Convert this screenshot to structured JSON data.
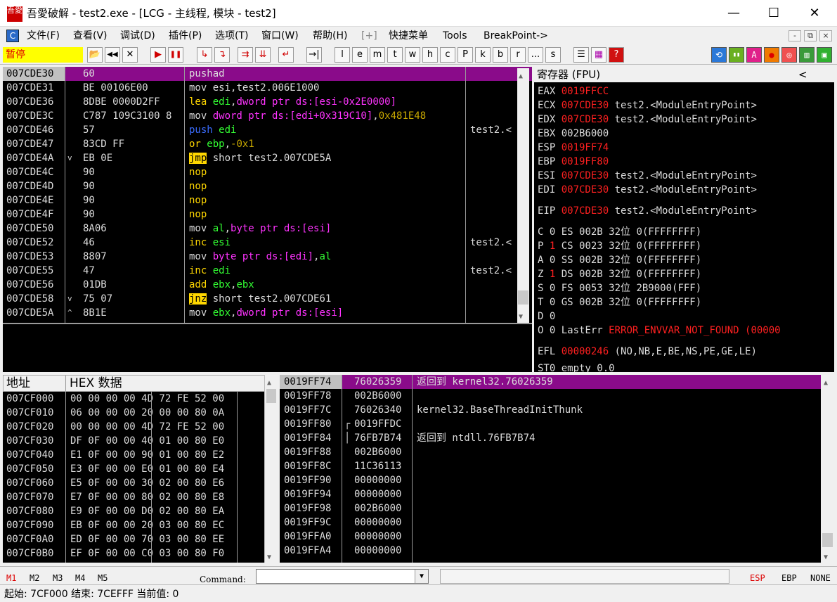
{
  "window": {
    "logo_text": "吾愛",
    "title": "吾愛破解 - test2.exe - [LCG - 主线程, 模块 - test2]",
    "minimize": "—",
    "maximize": "☐",
    "close": "✕"
  },
  "menu": {
    "items": [
      "文件(F)",
      "查看(V)",
      "调试(D)",
      "插件(P)",
      "选项(T)",
      "窗口(W)",
      "帮助(H)",
      "[+]",
      "快捷菜单",
      "Tools",
      "BreakPoint->"
    ],
    "mdi": [
      "-",
      "⧉",
      "×"
    ]
  },
  "toolbar": {
    "status": "暂停",
    "buttons": [
      "📂",
      "◀◀",
      "✕",
      "▶",
      "❚❚",
      "↳",
      "↴",
      "⇉",
      "⇊",
      "↵",
      "→|"
    ],
    "letters": [
      "l",
      "e",
      "m",
      "t",
      "w",
      "h",
      "c",
      "P",
      "k",
      "b",
      "r",
      "...",
      "s"
    ],
    "right": [
      "☰",
      "▦",
      "?"
    ],
    "plugin_icons": [
      "⟲",
      "▮▮",
      "A",
      "●",
      "◎",
      "▥",
      "▣"
    ]
  },
  "cpu": {
    "rows": [
      {
        "addr": "007CDE30",
        "hex": "60",
        "asm": [
          {
            "t": "pushad",
            "c": "txt"
          }
        ],
        "cmt": "",
        "sel": true
      },
      {
        "addr": "007CDE31",
        "hex": "BE 00106E00",
        "asm": [
          {
            "t": "mov ",
            "c": "kw-mov"
          },
          {
            "t": "esi",
            "c": "txt"
          },
          {
            "t": ",test2.006E1000",
            "c": "txt"
          }
        ],
        "cmt": ""
      },
      {
        "addr": "007CDE36",
        "hex": "8DBE 0000D2FF",
        "asm": [
          {
            "t": "lea ",
            "c": "kw-lea"
          },
          {
            "t": "edi",
            "c": "reg"
          },
          {
            "t": ",",
            "c": "txt"
          },
          {
            "t": "dword ptr ds:[esi-0x2E0000]",
            "c": "mem"
          }
        ],
        "cmt": ""
      },
      {
        "addr": "007CDE3C",
        "hex": "C787 109C3100 8",
        "asm": [
          {
            "t": "mov ",
            "c": "kw-mov"
          },
          {
            "t": "dword ptr ds:[edi+0x319C10]",
            "c": "mem"
          },
          {
            "t": ",",
            "c": "txt"
          },
          {
            "t": "0x481E48",
            "c": "num"
          }
        ],
        "cmt": ""
      },
      {
        "addr": "007CDE46",
        "hex": "57",
        "asm": [
          {
            "t": "push ",
            "c": "kw-push"
          },
          {
            "t": "edi",
            "c": "reg"
          }
        ],
        "cmt": "test2.<"
      },
      {
        "addr": "007CDE47",
        "hex": "83CD FF",
        "asm": [
          {
            "t": "or ",
            "c": "kw-or"
          },
          {
            "t": "ebp",
            "c": "reg"
          },
          {
            "t": ",",
            "c": "txt"
          },
          {
            "t": "-0x1",
            "c": "num"
          }
        ],
        "cmt": ""
      },
      {
        "addr": "007CDE4A",
        "hex": "EB 0E",
        "asm": [
          {
            "t": "jmp",
            "c": "kw-jmp"
          },
          {
            "t": " short test2.007CDE5A",
            "c": "txt"
          }
        ],
        "cmt": "",
        "mark": "v"
      },
      {
        "addr": "007CDE4C",
        "hex": "90",
        "asm": [
          {
            "t": "nop",
            "c": "kw-nop"
          }
        ],
        "cmt": ""
      },
      {
        "addr": "007CDE4D",
        "hex": "90",
        "asm": [
          {
            "t": "nop",
            "c": "kw-nop"
          }
        ],
        "cmt": ""
      },
      {
        "addr": "007CDE4E",
        "hex": "90",
        "asm": [
          {
            "t": "nop",
            "c": "kw-nop"
          }
        ],
        "cmt": ""
      },
      {
        "addr": "007CDE4F",
        "hex": "90",
        "asm": [
          {
            "t": "nop",
            "c": "kw-nop"
          }
        ],
        "cmt": ""
      },
      {
        "addr": "007CDE50",
        "hex": "8A06",
        "asm": [
          {
            "t": "mov ",
            "c": "kw-mov"
          },
          {
            "t": "al",
            "c": "reg"
          },
          {
            "t": ",",
            "c": "txt"
          },
          {
            "t": "byte ptr ds:[esi]",
            "c": "mem"
          }
        ],
        "cmt": ""
      },
      {
        "addr": "007CDE52",
        "hex": "46",
        "asm": [
          {
            "t": "inc ",
            "c": "kw-inc"
          },
          {
            "t": "esi",
            "c": "reg"
          }
        ],
        "cmt": "test2.<"
      },
      {
        "addr": "007CDE53",
        "hex": "8807",
        "asm": [
          {
            "t": "mov ",
            "c": "kw-mov"
          },
          {
            "t": "byte ptr ds:[edi]",
            "c": "mem"
          },
          {
            "t": ",",
            "c": "txt"
          },
          {
            "t": "al",
            "c": "reg"
          }
        ],
        "cmt": ""
      },
      {
        "addr": "007CDE55",
        "hex": "47",
        "asm": [
          {
            "t": "inc ",
            "c": "kw-inc"
          },
          {
            "t": "edi",
            "c": "reg"
          }
        ],
        "cmt": "test2.<"
      },
      {
        "addr": "007CDE56",
        "hex": "01DB",
        "asm": [
          {
            "t": "add ",
            "c": "kw-add"
          },
          {
            "t": "ebx",
            "c": "reg"
          },
          {
            "t": ",",
            "c": "txt"
          },
          {
            "t": "ebx",
            "c": "reg"
          }
        ],
        "cmt": ""
      },
      {
        "addr": "007CDE58",
        "hex": "75 07",
        "asm": [
          {
            "t": "jnz",
            "c": "kw-jmp"
          },
          {
            "t": " short test2.007CDE61",
            "c": "txt"
          }
        ],
        "cmt": "",
        "mark": "v"
      },
      {
        "addr": "007CDE5A",
        "hex": "8B1E",
        "asm": [
          {
            "t": "mov ",
            "c": "kw-mov"
          },
          {
            "t": "ebx",
            "c": "reg"
          },
          {
            "t": ",",
            "c": "txt"
          },
          {
            "t": "dword ptr ds:[esi]",
            "c": "mem"
          }
        ],
        "cmt": "",
        "mark": "^"
      }
    ]
  },
  "registers": {
    "header": "寄存器 (FPU)",
    "header_arrow": "<",
    "gp": [
      {
        "n": "EAX",
        "v": "0019FFCC",
        "red": true,
        "c": ""
      },
      {
        "n": "ECX",
        "v": "007CDE30",
        "red": true,
        "c": "test2.<ModuleEntryPoint>"
      },
      {
        "n": "EDX",
        "v": "007CDE30",
        "red": true,
        "c": "test2.<ModuleEntryPoint>"
      },
      {
        "n": "EBX",
        "v": "002B6000",
        "red": false,
        "c": ""
      },
      {
        "n": "ESP",
        "v": "0019FF74",
        "red": true,
        "c": ""
      },
      {
        "n": "EBP",
        "v": "0019FF80",
        "red": true,
        "c": ""
      },
      {
        "n": "ESI",
        "v": "007CDE30",
        "red": true,
        "c": "test2.<ModuleEntryPoint>"
      },
      {
        "n": "EDI",
        "v": "007CDE30",
        "red": true,
        "c": "test2.<ModuleEntryPoint>"
      }
    ],
    "eip": {
      "n": "EIP",
      "v": "007CDE30",
      "c": "test2.<ModuleEntryPoint>"
    },
    "flags": [
      {
        "f": "C",
        "b": "0",
        "red": false,
        "seg": "ES 002B 32位 0(FFFFFFFF)"
      },
      {
        "f": "P",
        "b": "1",
        "red": true,
        "seg": "CS 0023 32位 0(FFFFFFFF)"
      },
      {
        "f": "A",
        "b": "0",
        "red": false,
        "seg": "SS 002B 32位 0(FFFFFFFF)"
      },
      {
        "f": "Z",
        "b": "1",
        "red": true,
        "seg": "DS 002B 32位 0(FFFFFFFF)"
      },
      {
        "f": "S",
        "b": "0",
        "red": false,
        "seg": "FS 0053 32位 2B9000(FFF)"
      },
      {
        "f": "T",
        "b": "0",
        "red": false,
        "seg": "GS 002B 32位 0(FFFFFFFF)"
      },
      {
        "f": "D",
        "b": "0",
        "red": false,
        "seg": ""
      },
      {
        "f": "O",
        "b": "0",
        "red": false,
        "seg": ""
      }
    ],
    "lasterr_label": "LastErr",
    "lasterr": "ERROR_ENVVAR_NOT_FOUND (00000",
    "efl_label": "EFL",
    "efl": "00000246",
    "efl_desc": "(NO,NB,E,BE,NS,PE,GE,LE)",
    "st0": "ST0 empty 0.0"
  },
  "dump": {
    "col_addr": "地址",
    "col_hex": "HEX 数据",
    "rows": [
      {
        "a": "007CF000",
        "h": "00 00 00 00 4D 72 FE 52 00"
      },
      {
        "a": "007CF010",
        "h": "06 00 00 00 20 00 00 80 0A"
      },
      {
        "a": "007CF020",
        "h": "00 00 00 00 4D 72 FE 52 00"
      },
      {
        "a": "007CF030",
        "h": "DF 0F 00 00 40 01 00 80 E0"
      },
      {
        "a": "007CF040",
        "h": "E1 0F 00 00 90 01 00 80 E2"
      },
      {
        "a": "007CF050",
        "h": "E3 0F 00 00 E0 01 00 80 E4"
      },
      {
        "a": "007CF060",
        "h": "E5 0F 00 00 30 02 00 80 E6"
      },
      {
        "a": "007CF070",
        "h": "E7 0F 00 00 80 02 00 80 E8"
      },
      {
        "a": "007CF080",
        "h": "E9 0F 00 00 D0 02 00 80 EA"
      },
      {
        "a": "007CF090",
        "h": "EB 0F 00 00 20 03 00 80 EC"
      },
      {
        "a": "007CF0A0",
        "h": "ED 0F 00 00 70 03 00 80 EE"
      },
      {
        "a": "007CF0B0",
        "h": "EF 0F 00 00 C0 03 00 80 F0"
      }
    ]
  },
  "stack": {
    "rows": [
      {
        "a": "0019FF74",
        "v": "76026359",
        "c": "返回到 kernel32.76026359",
        "sel": true
      },
      {
        "a": "0019FF78",
        "v": "002B6000",
        "c": ""
      },
      {
        "a": "0019FF7C",
        "v": "76026340",
        "c": "kernel32.BaseThreadInitThunk"
      },
      {
        "a": "0019FF80",
        "v": "0019FFDC",
        "c": "",
        "bracket": "top"
      },
      {
        "a": "0019FF84",
        "v": "76FB7B74",
        "c": "返回到 ntdll.76FB7B74",
        "bracket": "bot"
      },
      {
        "a": "0019FF88",
        "v": "002B6000",
        "c": ""
      },
      {
        "a": "0019FF8C",
        "v": "11C36113",
        "c": ""
      },
      {
        "a": "0019FF90",
        "v": "00000000",
        "c": ""
      },
      {
        "a": "0019FF94",
        "v": "00000000",
        "c": ""
      },
      {
        "a": "0019FF98",
        "v": "002B6000",
        "c": ""
      },
      {
        "a": "0019FF9C",
        "v": "00000000",
        "c": ""
      },
      {
        "a": "0019FFA0",
        "v": "00000000",
        "c": ""
      },
      {
        "a": "0019FFA4",
        "v": "00000000",
        "c": ""
      }
    ]
  },
  "cmdbar": {
    "tabs": [
      "M1",
      "M2",
      "M3",
      "M4",
      "M5"
    ],
    "label": "Command:",
    "input_value": "",
    "dropdown": "▼",
    "right": [
      "ESP",
      "EBP",
      "NONE"
    ]
  },
  "status": {
    "text": "起始: 7CF000 结束: 7CEFFF 当前值: 0"
  },
  "colors": {
    "selection": "#8a0b8a",
    "register_changed": "#ff2020",
    "jump_bg": "#ffd700"
  }
}
